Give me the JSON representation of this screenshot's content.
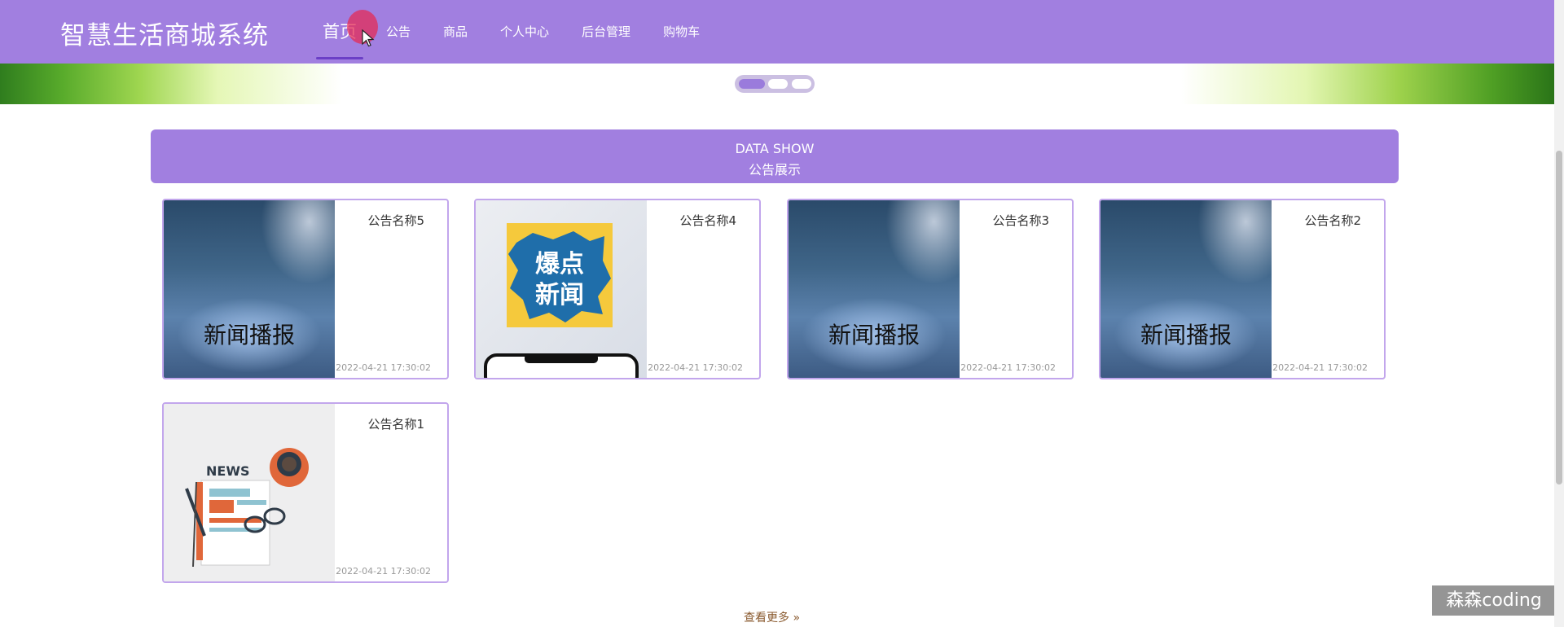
{
  "header": {
    "site_title": "智慧生活商城系统",
    "nav": [
      "首页",
      "公告",
      "商品",
      "个人中心",
      "后台管理",
      "购物车"
    ],
    "active_index": 0,
    "brand_color": "#a17fe0"
  },
  "carousel": {
    "slide_count": 3,
    "active": 0
  },
  "section": {
    "title_en": "DATA SHOW",
    "title_cn": "公告展示"
  },
  "cards": [
    {
      "title": "公告名称5",
      "time": "2022-04-21 17:30:02",
      "image": "storm-news",
      "image_text": "新闻播报"
    },
    {
      "title": "公告名称4",
      "time": "2022-04-21 17:30:02",
      "image": "breaking-news-phone",
      "image_text": "爆点新闻"
    },
    {
      "title": "公告名称3",
      "time": "2022-04-21 17:30:02",
      "image": "storm-news",
      "image_text": "新闻播报"
    },
    {
      "title": "公告名称2",
      "time": "2022-04-21 17:30:02",
      "image": "storm-news",
      "image_text": "新闻播报"
    },
    {
      "title": "公告名称1",
      "time": "2022-04-21 17:30:02",
      "image": "newspaper-illustration",
      "image_text": "NEWS"
    }
  ],
  "more_link": "查看更多 »",
  "watermark": "森森coding"
}
